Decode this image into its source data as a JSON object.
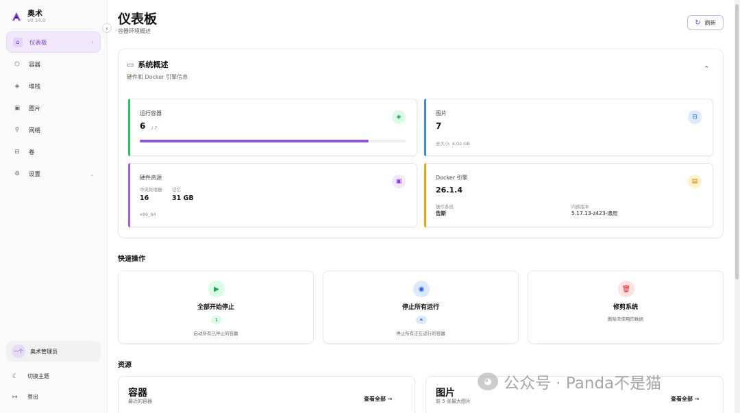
{
  "sidebar": {
    "app_name": "奥术",
    "version": "v0.14.0",
    "collapse_icon": "‹",
    "items": [
      {
        "label": "仪表板",
        "icon": "⌂",
        "trail": "›"
      },
      {
        "label": "容器",
        "icon": "⬡"
      },
      {
        "label": "堆栈",
        "icon": "◈"
      },
      {
        "label": "图片",
        "icon": "▣"
      },
      {
        "label": "网络",
        "icon": "⚲"
      },
      {
        "label": "卷",
        "icon": "⊟"
      },
      {
        "label": "设置",
        "icon": "⚙",
        "trail": "⌄"
      }
    ],
    "user": {
      "avatar_text": "一个",
      "name": "奥术管理员"
    },
    "theme_toggle": {
      "label": "切换主题",
      "icon": "☾"
    },
    "logout": {
      "label": "登出",
      "icon": "↦"
    }
  },
  "header": {
    "title": "仪表板",
    "subtitle": "容器环境概述",
    "refresh_label": "刷新",
    "refresh_icon": "↻"
  },
  "overview": {
    "title": "系统概述",
    "title_icon": "▭",
    "subtitle": "硬件和 Docker 引擎信息",
    "collapse_icon": "⌃",
    "running": {
      "label": "运行容器",
      "value": "6",
      "total": "/ 7",
      "progress": 0.86,
      "icon": "◈"
    },
    "images": {
      "label": "图片",
      "value": "7",
      "size": "总大小: 4.02 GB",
      "icon": "⊟"
    },
    "hardware": {
      "label": "硬件资源",
      "cpu_label": "中央处理器",
      "cpu_value": "16",
      "mem_label": "记忆",
      "mem_value": "31 GB",
      "arch": "x86_64",
      "icon": "▣"
    },
    "docker": {
      "label": "Docker 引擎",
      "version": "26.1.4",
      "os_label": "操作系统",
      "os_value": "告斯",
      "kernel_label": "内核版本",
      "kernel_value": "5.17.13-z423-通用",
      "icon": "▤"
    }
  },
  "quick_actions": {
    "title": "快速操作",
    "start": {
      "title": "全部开始停止",
      "count": "1",
      "desc": "启动所有已停止的容器",
      "icon": "▶"
    },
    "stop": {
      "title": "停止所有运行",
      "count": "6",
      "desc": "停止所有正在运行的容器",
      "icon": "◉"
    },
    "prune": {
      "title": "修剪系统",
      "desc": "删除未使用的数据",
      "icon": "🗑"
    }
  },
  "resources": {
    "title": "资源",
    "containers": {
      "title": "容器",
      "subtitle": "最近的容器",
      "view_all": "查看全部 →"
    },
    "images": {
      "title": "图片",
      "subtitle": "前 5 张最大图片",
      "view_all": "查看全部 →"
    }
  },
  "watermark": {
    "text": "公众号 · Panda不是猫",
    "icon": "◕"
  },
  "colors": {
    "accent": "#7b3fd1",
    "green": "#22c55e",
    "blue": "#3b82f6",
    "purple": "#a855f7",
    "orange": "#f59e0b",
    "red": "#ef4444"
  }
}
